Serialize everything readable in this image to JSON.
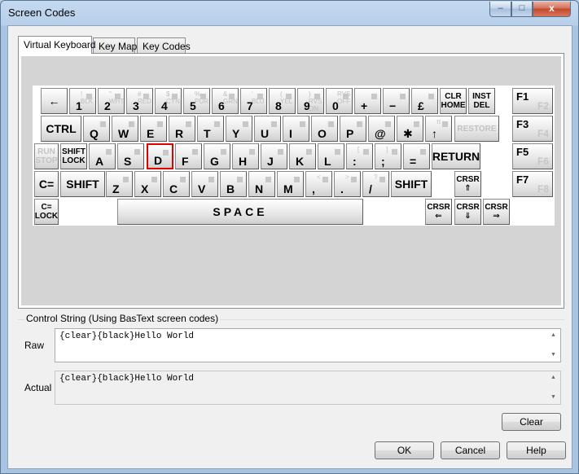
{
  "window": {
    "title": "Screen Codes"
  },
  "titlebar": {
    "min_label": "–",
    "max_label": "□",
    "close_label": "x"
  },
  "tabs": [
    {
      "label": "Virtual Keyboard"
    },
    {
      "label": "Key Map"
    },
    {
      "label": "Key Codes"
    }
  ],
  "keyboard": {
    "rows": [
      [
        {
          "main": "←"
        },
        {
          "main": "1",
          "sub": "!  BLK"
        },
        {
          "main": "2",
          "sub": "\"  WHT"
        },
        {
          "main": "3",
          "sub": "#  RED"
        },
        {
          "main": "4",
          "sub": "$  CYN"
        },
        {
          "main": "5",
          "sub": "%  PUR"
        },
        {
          "main": "6",
          "sub": "&  GRN"
        },
        {
          "main": "7",
          "sub": "'  BLU"
        },
        {
          "main": "8",
          "sub": "(  YEL"
        },
        {
          "main": "9",
          "sub": ")  RVS ON"
        },
        {
          "main": "0",
          "sub": "RVS OFF"
        },
        {
          "main": "+"
        },
        {
          "main": "−"
        },
        {
          "main": "£"
        },
        {
          "main": "HOME",
          "sub": "CLR"
        },
        {
          "main": "DEL",
          "sub": "INST"
        },
        {
          "main": "F1",
          "sub": "F2"
        }
      ],
      [
        {
          "main": "CTRL"
        },
        {
          "main": "Q"
        },
        {
          "main": "W"
        },
        {
          "main": "E"
        },
        {
          "main": "R"
        },
        {
          "main": "T"
        },
        {
          "main": "Y"
        },
        {
          "main": "U"
        },
        {
          "main": "I"
        },
        {
          "main": "O"
        },
        {
          "main": "P"
        },
        {
          "main": "@"
        },
        {
          "main": "✱"
        },
        {
          "main": "↑",
          "sub": "π"
        },
        {
          "main": "RESTORE"
        },
        {
          "main": "F3",
          "sub": "F4"
        }
      ],
      [
        {
          "main": "RUN STOP"
        },
        {
          "main": "SHIFT LOCK"
        },
        {
          "main": "A"
        },
        {
          "main": "S"
        },
        {
          "main": "D"
        },
        {
          "main": "F"
        },
        {
          "main": "G"
        },
        {
          "main": "H"
        },
        {
          "main": "J"
        },
        {
          "main": "K"
        },
        {
          "main": "L"
        },
        {
          "main": ":",
          "sub": "["
        },
        {
          "main": ";",
          "sub": "]"
        },
        {
          "main": "="
        },
        {
          "main": "RETURN"
        },
        {
          "main": "F5",
          "sub": "F6"
        }
      ],
      [
        {
          "main": "C="
        },
        {
          "main": "SHIFT"
        },
        {
          "main": "Z"
        },
        {
          "main": "X"
        },
        {
          "main": "C"
        },
        {
          "main": "V"
        },
        {
          "main": "B"
        },
        {
          "main": "N"
        },
        {
          "main": "M"
        },
        {
          "main": ",",
          "sub": "<"
        },
        {
          "main": ".",
          "sub": ">"
        },
        {
          "main": "/",
          "sub": "?"
        },
        {
          "main": "SHIFT"
        },
        {
          "main": "CRSR ⇑"
        },
        {
          "main": "F7",
          "sub": "F8"
        }
      ],
      [
        {
          "main": "C= LOCK"
        },
        {
          "main": "SPACE"
        },
        {
          "main": "CRSR ⇐"
        },
        {
          "main": "CRSR ⇓"
        },
        {
          "main": "CRSR ⇒"
        }
      ]
    ],
    "selected_key": "D"
  },
  "control_string": {
    "group_label": "Control String (Using BasText screen codes)",
    "raw_label": "Raw",
    "raw_value": "{clear}{black}Hello World",
    "actual_label": "Actual",
    "actual_value": "{clear}{black}Hello World"
  },
  "buttons": {
    "clear": "Clear",
    "ok": "OK",
    "cancel": "Cancel",
    "help": "Help"
  }
}
